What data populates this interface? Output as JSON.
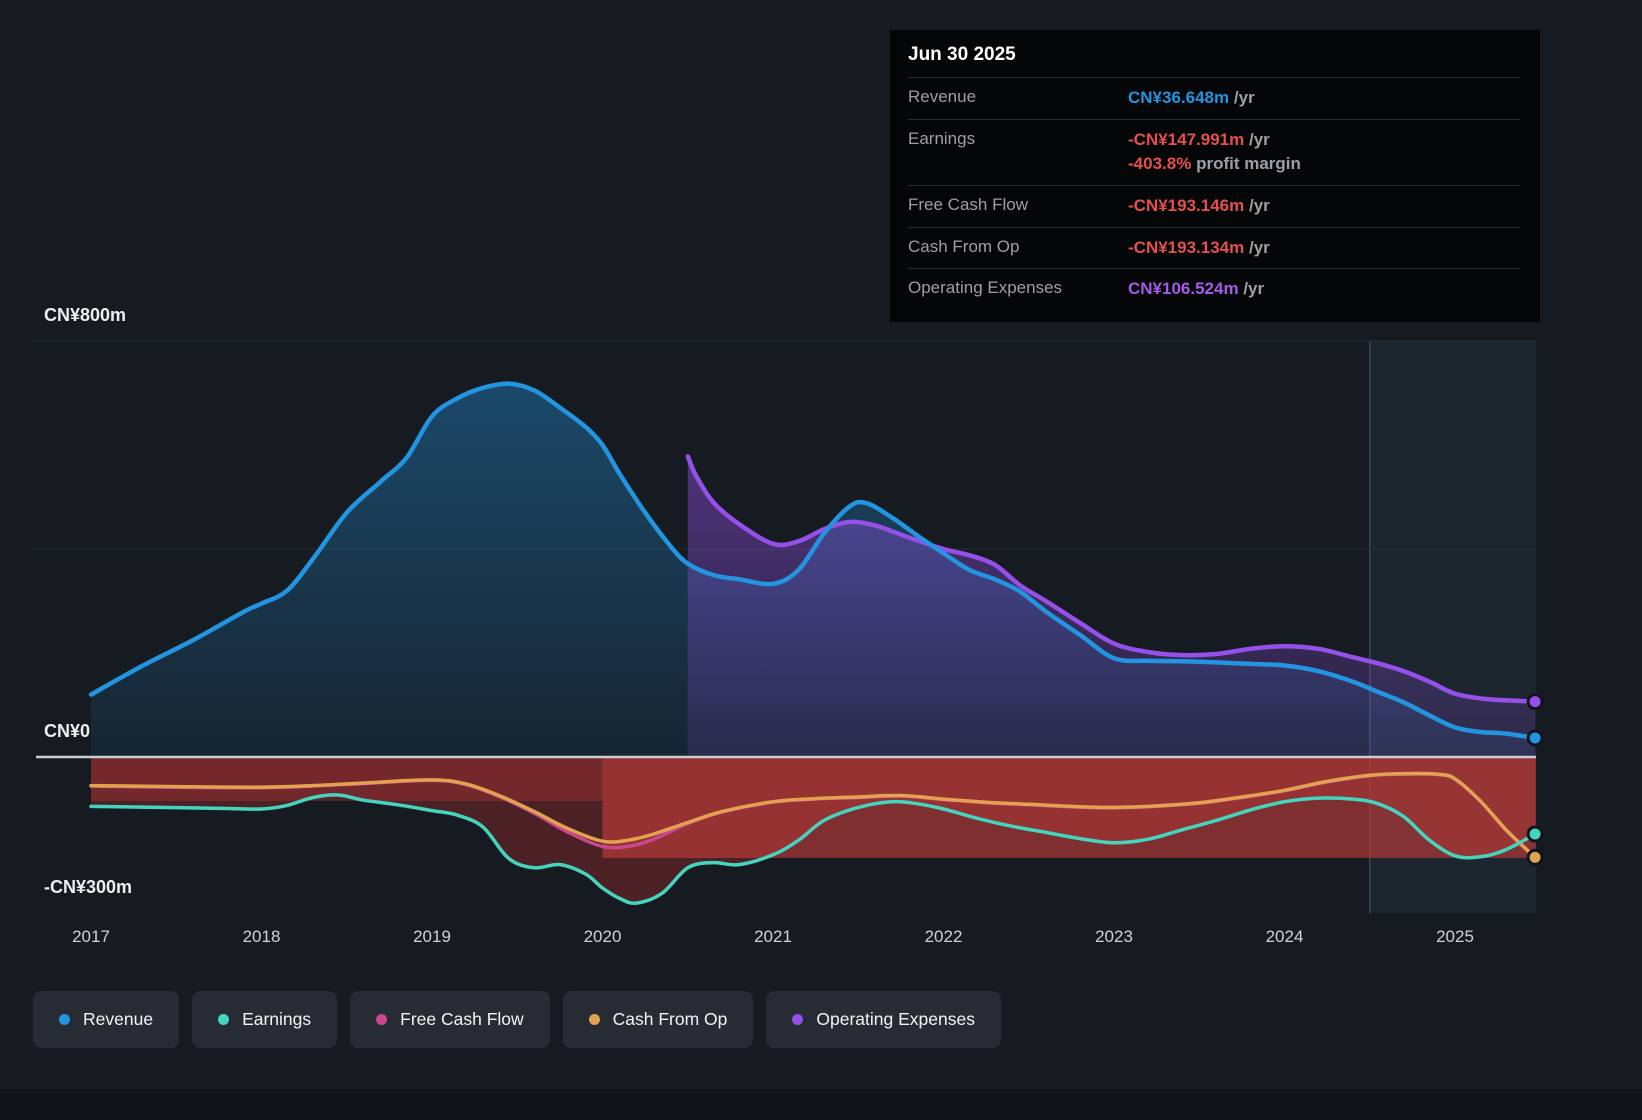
{
  "colors": {
    "revenue": "#2394df",
    "earnings": "#45d5bf",
    "free_cash_flow": "#c9498f",
    "cash_from_op": "#e2a34e",
    "operating_expenses": "#9450e8",
    "negative_red": "#e4504e",
    "background": "#161b22"
  },
  "tooltip": {
    "date": "Jun 30 2025",
    "rows": [
      {
        "label": "Revenue",
        "value": "CN¥36.648m",
        "suffix": "/yr"
      },
      {
        "label": "Earnings",
        "value": "-CN¥147.991m",
        "suffix": "/yr",
        "margin_value": "-403.8%",
        "margin_label": "profit margin"
      },
      {
        "label": "Free Cash Flow",
        "value": "-CN¥193.146m",
        "suffix": "/yr"
      },
      {
        "label": "Cash From Op",
        "value": "-CN¥193.134m",
        "suffix": "/yr"
      },
      {
        "label": "Operating Expenses",
        "value": "CN¥106.524m",
        "suffix": "/yr"
      }
    ]
  },
  "axis": {
    "y": [
      "CN¥800m",
      "CN¥0",
      "-CN¥300m"
    ],
    "x": [
      "2017",
      "2018",
      "2019",
      "2020",
      "2021",
      "2022",
      "2023",
      "2024",
      "2025"
    ]
  },
  "legend": [
    {
      "label": "Revenue",
      "color": "#2394df"
    },
    {
      "label": "Earnings",
      "color": "#45d5bf"
    },
    {
      "label": "Free Cash Flow",
      "color": "#c9498f"
    },
    {
      "label": "Cash From Op",
      "color": "#e2a34e"
    },
    {
      "label": "Operating Expenses",
      "color": "#9450e8"
    }
  ],
  "chart_data": {
    "type": "area",
    "title": "Earnings and Revenue History (CN¥ millions)",
    "ylabel": "CN¥m",
    "ylim": [
      -300,
      800
    ],
    "x_range": [
      2017,
      2025.5
    ],
    "x_ticks": [
      2017,
      2018,
      2019,
      2020,
      2021,
      2022,
      2023,
      2024,
      2025
    ],
    "gridlines": [
      800,
      400
    ],
    "zero_line": 0,
    "forecast_divider_x": 2024.5,
    "negative_zone_split_x": 2020.0,
    "legend_position": "bottom",
    "series": [
      {
        "name": "Revenue",
        "color": "#2394df",
        "fill": "gradient-blue",
        "points": [
          [
            2017.0,
            120
          ],
          [
            2017.3,
            175
          ],
          [
            2017.6,
            225
          ],
          [
            2017.9,
            280
          ],
          [
            2018.0,
            295
          ],
          [
            2018.15,
            320
          ],
          [
            2018.3,
            380
          ],
          [
            2018.5,
            470
          ],
          [
            2018.7,
            530
          ],
          [
            2018.85,
            575
          ],
          [
            2019.0,
            655
          ],
          [
            2019.15,
            690
          ],
          [
            2019.3,
            710
          ],
          [
            2019.45,
            718
          ],
          [
            2019.6,
            705
          ],
          [
            2019.75,
            672
          ],
          [
            2019.9,
            635
          ],
          [
            2020.0,
            600
          ],
          [
            2020.1,
            545
          ],
          [
            2020.25,
            470
          ],
          [
            2020.4,
            405
          ],
          [
            2020.5,
            372
          ],
          [
            2020.65,
            350
          ],
          [
            2020.8,
            342
          ],
          [
            2021.0,
            333
          ],
          [
            2021.15,
            360
          ],
          [
            2021.3,
            430
          ],
          [
            2021.45,
            482
          ],
          [
            2021.55,
            488
          ],
          [
            2021.7,
            460
          ],
          [
            2021.85,
            425
          ],
          [
            2022.0,
            392
          ],
          [
            2022.15,
            360
          ],
          [
            2022.3,
            342
          ],
          [
            2022.45,
            318
          ],
          [
            2022.6,
            280
          ],
          [
            2022.8,
            235
          ],
          [
            2023.0,
            190
          ],
          [
            2023.2,
            185
          ],
          [
            2023.4,
            184
          ],
          [
            2023.6,
            182
          ],
          [
            2023.8,
            179
          ],
          [
            2024.0,
            176
          ],
          [
            2024.2,
            165
          ],
          [
            2024.4,
            145
          ],
          [
            2024.55,
            125
          ],
          [
            2024.7,
            105
          ],
          [
            2024.85,
            80
          ],
          [
            2025.0,
            57
          ],
          [
            2025.15,
            48
          ],
          [
            2025.3,
            45
          ],
          [
            2025.47,
            36.6
          ]
        ]
      },
      {
        "name": "Operating Expenses",
        "color": "#9450e8",
        "fill": "gradient-purple",
        "points": [
          [
            2020.5,
            578
          ],
          [
            2020.55,
            540
          ],
          [
            2020.65,
            490
          ],
          [
            2020.8,
            448
          ],
          [
            2021.0,
            410
          ],
          [
            2021.15,
            415
          ],
          [
            2021.3,
            438
          ],
          [
            2021.45,
            452
          ],
          [
            2021.6,
            445
          ],
          [
            2021.8,
            422
          ],
          [
            2022.0,
            400
          ],
          [
            2022.15,
            388
          ],
          [
            2022.3,
            370
          ],
          [
            2022.45,
            330
          ],
          [
            2022.6,
            300
          ],
          [
            2022.8,
            258
          ],
          [
            2023.0,
            218
          ],
          [
            2023.2,
            202
          ],
          [
            2023.4,
            196
          ],
          [
            2023.6,
            198
          ],
          [
            2023.8,
            208
          ],
          [
            2024.0,
            213
          ],
          [
            2024.2,
            208
          ],
          [
            2024.4,
            192
          ],
          [
            2024.55,
            180
          ],
          [
            2024.7,
            165
          ],
          [
            2024.85,
            145
          ],
          [
            2025.0,
            122
          ],
          [
            2025.2,
            111
          ],
          [
            2025.47,
            106.5
          ]
        ]
      },
      {
        "name": "Earnings",
        "color": "#45d5bf",
        "fill": "negative-red",
        "points": [
          [
            2017.0,
            -95
          ],
          [
            2017.4,
            -97
          ],
          [
            2017.8,
            -99
          ],
          [
            2018.0,
            -100
          ],
          [
            2018.15,
            -93
          ],
          [
            2018.3,
            -78
          ],
          [
            2018.45,
            -73
          ],
          [
            2018.6,
            -83
          ],
          [
            2018.8,
            -92
          ],
          [
            2019.0,
            -103
          ],
          [
            2019.15,
            -112
          ],
          [
            2019.3,
            -135
          ],
          [
            2019.45,
            -195
          ],
          [
            2019.6,
            -213
          ],
          [
            2019.75,
            -207
          ],
          [
            2019.9,
            -225
          ],
          [
            2020.0,
            -252
          ],
          [
            2020.1,
            -272
          ],
          [
            2020.2,
            -281
          ],
          [
            2020.35,
            -262
          ],
          [
            2020.5,
            -213
          ],
          [
            2020.65,
            -203
          ],
          [
            2020.8,
            -207
          ],
          [
            2021.0,
            -188
          ],
          [
            2021.15,
            -160
          ],
          [
            2021.3,
            -122
          ],
          [
            2021.5,
            -97
          ],
          [
            2021.7,
            -86
          ],
          [
            2021.85,
            -90
          ],
          [
            2022.0,
            -100
          ],
          [
            2022.2,
            -118
          ],
          [
            2022.4,
            -133
          ],
          [
            2022.6,
            -145
          ],
          [
            2022.8,
            -157
          ],
          [
            2023.0,
            -165
          ],
          [
            2023.2,
            -158
          ],
          [
            2023.4,
            -140
          ],
          [
            2023.6,
            -122
          ],
          [
            2023.8,
            -102
          ],
          [
            2024.0,
            -86
          ],
          [
            2024.2,
            -79
          ],
          [
            2024.4,
            -81
          ],
          [
            2024.55,
            -90
          ],
          [
            2024.7,
            -115
          ],
          [
            2024.85,
            -160
          ],
          [
            2025.0,
            -190
          ],
          [
            2025.15,
            -192
          ],
          [
            2025.3,
            -178
          ],
          [
            2025.47,
            -147.99
          ]
        ]
      },
      {
        "name": "Free Cash Flow",
        "color": "#c9498f",
        "fill": "none",
        "points": [
          [
            2017.0,
            -56
          ],
          [
            2017.5,
            -58
          ],
          [
            2018.0,
            -59
          ],
          [
            2018.3,
            -56
          ],
          [
            2018.6,
            -51
          ],
          [
            2019.0,
            -45
          ],
          [
            2019.2,
            -53
          ],
          [
            2019.4,
            -77
          ],
          [
            2019.6,
            -108
          ],
          [
            2019.8,
            -145
          ],
          [
            2020.0,
            -172
          ],
          [
            2020.15,
            -172
          ],
          [
            2020.3,
            -158
          ],
          [
            2020.5,
            -128
          ],
          [
            2020.7,
            -106
          ],
          [
            2021.0,
            -87
          ],
          [
            2021.25,
            -81
          ],
          [
            2021.5,
            -78
          ],
          [
            2021.75,
            -75
          ],
          [
            2022.0,
            -82
          ],
          [
            2022.25,
            -88
          ],
          [
            2022.5,
            -92
          ],
          [
            2022.75,
            -96
          ],
          [
            2023.0,
            -98
          ],
          [
            2023.25,
            -95
          ],
          [
            2023.5,
            -89
          ],
          [
            2023.75,
            -78
          ],
          [
            2024.0,
            -65
          ],
          [
            2024.25,
            -48
          ],
          [
            2024.5,
            -36
          ],
          [
            2024.7,
            -33
          ],
          [
            2024.9,
            -34
          ],
          [
            2025.0,
            -43
          ],
          [
            2025.15,
            -86
          ],
          [
            2025.3,
            -141
          ],
          [
            2025.47,
            -193.15
          ]
        ]
      },
      {
        "name": "Cash From Op",
        "color": "#e2a34e",
        "fill": "none",
        "points": [
          [
            2017.0,
            -55
          ],
          [
            2017.5,
            -57
          ],
          [
            2018.0,
            -58
          ],
          [
            2018.3,
            -55
          ],
          [
            2018.6,
            -50
          ],
          [
            2019.0,
            -44
          ],
          [
            2019.2,
            -52
          ],
          [
            2019.4,
            -75
          ],
          [
            2019.6,
            -105
          ],
          [
            2019.8,
            -138
          ],
          [
            2020.0,
            -162
          ],
          [
            2020.15,
            -160
          ],
          [
            2020.3,
            -148
          ],
          [
            2020.5,
            -126
          ],
          [
            2020.7,
            -105
          ],
          [
            2021.0,
            -86
          ],
          [
            2021.25,
            -80
          ],
          [
            2021.5,
            -77
          ],
          [
            2021.75,
            -74
          ],
          [
            2022.0,
            -81
          ],
          [
            2022.25,
            -87
          ],
          [
            2022.5,
            -91
          ],
          [
            2022.75,
            -95
          ],
          [
            2023.0,
            -97
          ],
          [
            2023.25,
            -94
          ],
          [
            2023.5,
            -88
          ],
          [
            2023.75,
            -77
          ],
          [
            2024.0,
            -64
          ],
          [
            2024.25,
            -47
          ],
          [
            2024.5,
            -35
          ],
          [
            2024.7,
            -32
          ],
          [
            2024.9,
            -33
          ],
          [
            2025.0,
            -42
          ],
          [
            2025.15,
            -85
          ],
          [
            2025.3,
            -140
          ],
          [
            2025.47,
            -193.13
          ]
        ]
      }
    ]
  }
}
